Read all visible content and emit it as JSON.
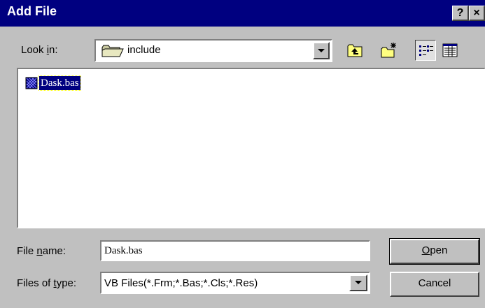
{
  "window": {
    "title": "Add File",
    "help_label": "?",
    "close_label": "×"
  },
  "look_in": {
    "label_pre": "Look ",
    "label_accel": "i",
    "label_post": "n:",
    "value": "include",
    "icon": "folder-icon"
  },
  "toolbar": {
    "up_icon": "up-one-level-icon",
    "new_folder_icon": "new-folder-icon",
    "list_icon": "list-view-icon",
    "details_icon": "details-view-icon"
  },
  "files": [
    {
      "name": "Dask.bas",
      "icon": "bas-file-icon",
      "selected": true
    }
  ],
  "file_name": {
    "label_pre": "File ",
    "label_accel": "n",
    "label_post": "ame:",
    "value": "Dask.bas"
  },
  "file_type": {
    "label_pre": "Files of ",
    "label_accel": "t",
    "label_post": "ype:",
    "value": "VB Files(*.Frm;*.Bas;*.Cls;*.Res)"
  },
  "buttons": {
    "open_accel": "O",
    "open_rest": "pen",
    "cancel": "Cancel"
  },
  "colors": {
    "titlebar": "#000080",
    "face": "#c0c0c0",
    "selection": "#000080"
  }
}
